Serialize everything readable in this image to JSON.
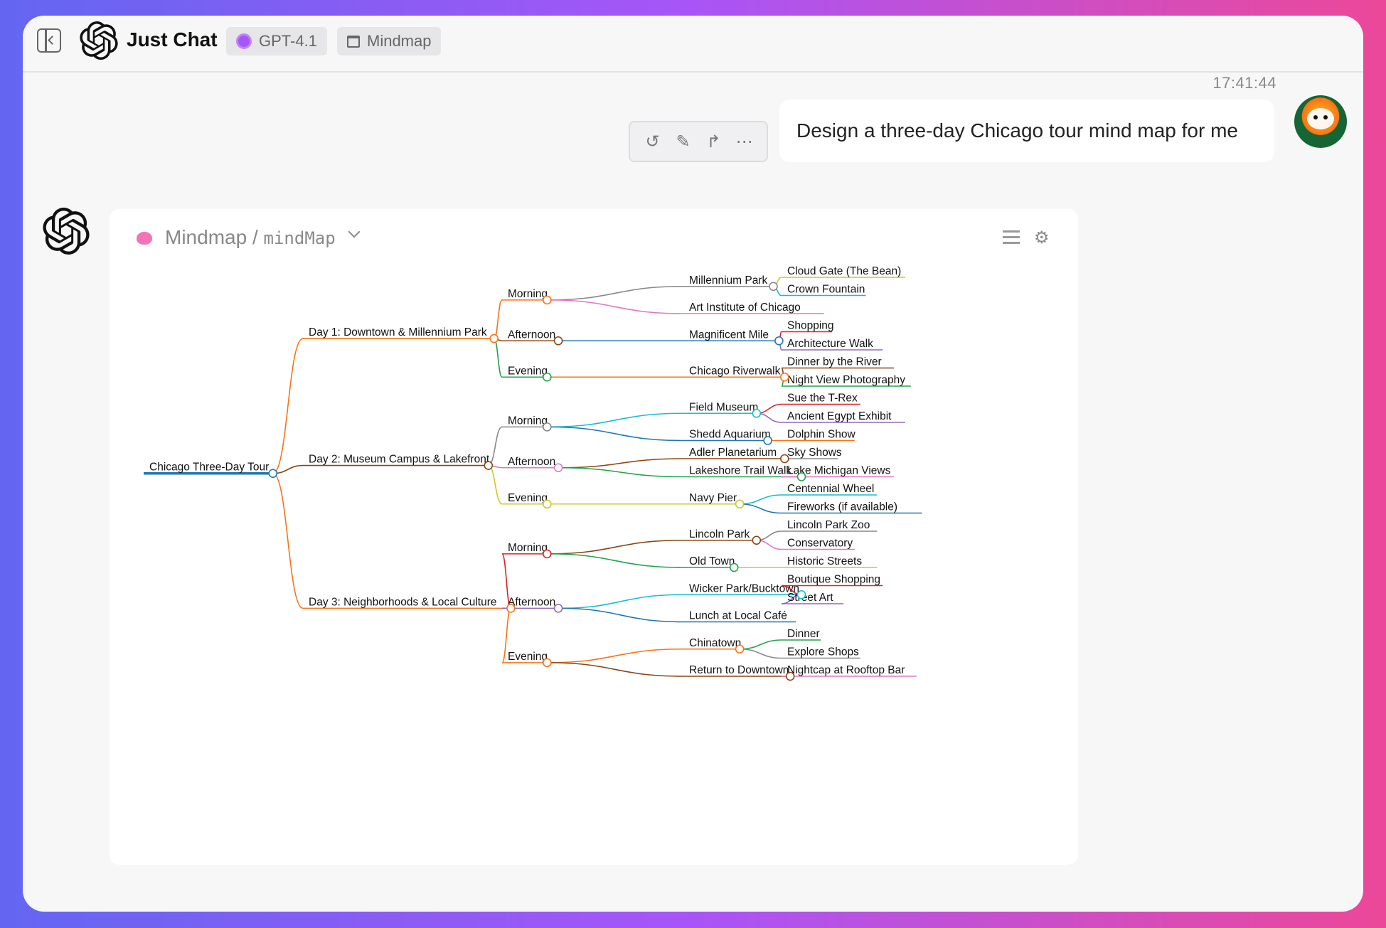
{
  "header": {
    "app_title": "Just Chat",
    "model_label": "GPT-4.1",
    "plugin_label": "Mindmap"
  },
  "conversation": {
    "timestamp": "17:41:44",
    "user_message": "Design a three-day Chicago tour mind map for me"
  },
  "card": {
    "title": "Mindmap",
    "separator": "/",
    "subtitle": "mindMap"
  },
  "colors": {
    "accent_purple": "#a855f7",
    "bg_gradient_left": "#6366f1",
    "bg_gradient_right": "#ec4899"
  },
  "mindmap": {
    "root": "Chicago Three-Day Tour",
    "branches": [
      {
        "label": "Day 1: Downtown & Millennium Park",
        "children": [
          {
            "label": "Morning",
            "children": [
              {
                "label": "Millennium Park",
                "children": [
                  "Cloud Gate (The Bean)",
                  "Crown Fountain"
                ]
              },
              {
                "label": "Art Institute of Chicago",
                "children": []
              }
            ]
          },
          {
            "label": "Afternoon",
            "children": [
              {
                "label": "Magnificent Mile",
                "children": [
                  "Shopping",
                  "Architecture Walk"
                ]
              }
            ]
          },
          {
            "label": "Evening",
            "children": [
              {
                "label": "Chicago Riverwalk",
                "children": [
                  "Dinner by the River",
                  "Night View Photography"
                ]
              }
            ]
          }
        ]
      },
      {
        "label": "Day 2: Museum Campus & Lakefront",
        "children": [
          {
            "label": "Morning",
            "children": [
              {
                "label": "Field Museum",
                "children": [
                  "Sue the T-Rex",
                  "Ancient Egypt Exhibit"
                ]
              },
              {
                "label": "Shedd Aquarium",
                "children": [
                  "Dolphin Show"
                ]
              }
            ]
          },
          {
            "label": "Afternoon",
            "children": [
              {
                "label": "Adler Planetarium",
                "children": [
                  "Sky Shows"
                ]
              },
              {
                "label": "Lakeshore Trail Walk",
                "children": [
                  "Lake Michigan Views"
                ]
              }
            ]
          },
          {
            "label": "Evening",
            "children": [
              {
                "label": "Navy Pier",
                "children": [
                  "Centennial Wheel",
                  "Fireworks (if available)"
                ]
              }
            ]
          }
        ]
      },
      {
        "label": "Day 3: Neighborhoods & Local Culture",
        "children": [
          {
            "label": "Morning",
            "children": [
              {
                "label": "Lincoln Park",
                "children": [
                  "Lincoln Park Zoo",
                  "Conservatory"
                ]
              },
              {
                "label": "Old Town",
                "children": [
                  "Historic Streets"
                ]
              }
            ]
          },
          {
            "label": "Afternoon",
            "children": [
              {
                "label": "Wicker Park/Bucktown",
                "children": [
                  "Boutique Shopping",
                  "Street Art"
                ]
              },
              {
                "label": "Lunch at Local Café",
                "children": []
              }
            ]
          },
          {
            "label": "Evening",
            "children": [
              {
                "label": "Chinatown",
                "children": [
                  "Dinner",
                  "Explore Shops"
                ]
              },
              {
                "label": "Return to Downtown",
                "children": [
                  "Nightcap at Rooftop Bar"
                ]
              }
            ]
          }
        ]
      }
    ]
  }
}
